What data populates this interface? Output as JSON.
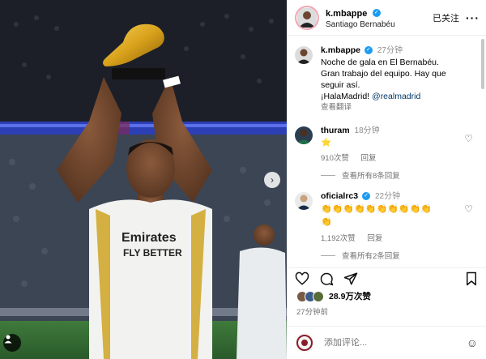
{
  "post": {
    "author": "k.mbappe",
    "location": "Santiago Bernabéu",
    "follow_state": "已关注",
    "more_icon": "more-dots-icon"
  },
  "caption": {
    "author": "k.mbappe",
    "time": "27分钟",
    "line1": "Noche de gala en El Bernabéu.",
    "line2": "Gran trabajo del equipo. Hay que",
    "line3": "seguir así.",
    "hashtag": "¡HalaMadrid!",
    "mention": "@realmadrid",
    "translate": "查看翻译"
  },
  "comments": [
    {
      "author": "thuram",
      "time": "18分钟",
      "text": "⭐",
      "likes": "910次赞",
      "reply": "回复",
      "view_replies": "查看所有8条回复"
    },
    {
      "author": "oficialrc3",
      "time": "22分钟",
      "text": "👏👏👏👏👏👏👏👏👏👏👏",
      "likes": "1,192次赞",
      "reply": "回复",
      "view_replies": "查看所有2条回复"
    }
  ],
  "stats": {
    "likes": "28.9万次赞",
    "posted": "27分钟前"
  },
  "composer": {
    "placeholder": "添加评论..."
  },
  "colors": {
    "verified": "#1d9bf0",
    "mention": "#00376b",
    "muted": "#737373",
    "grass": "#2e5b35"
  }
}
